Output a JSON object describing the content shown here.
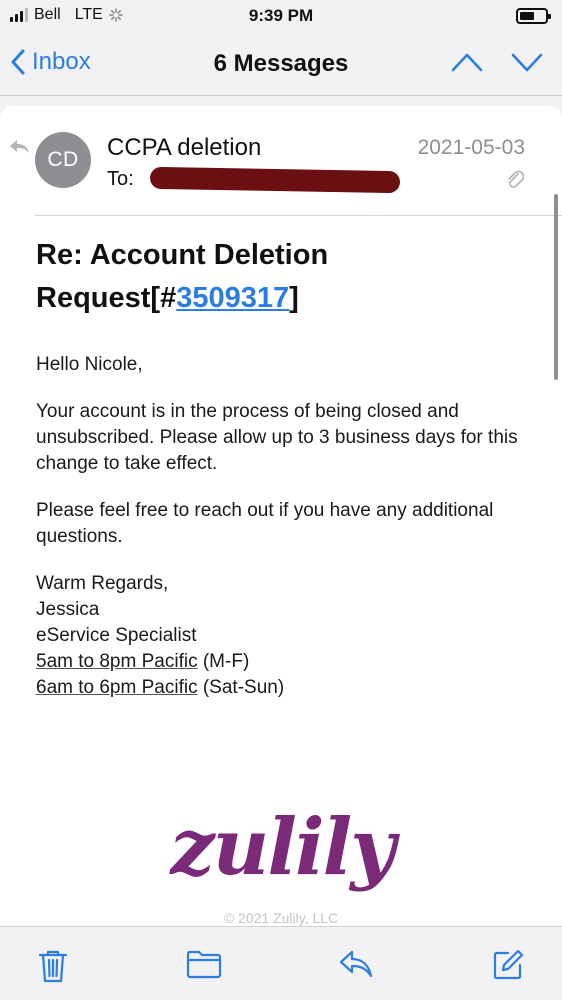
{
  "status": {
    "carrier": "Bell",
    "network": "LTE",
    "time": "9:39 PM"
  },
  "nav": {
    "back_label": "Inbox",
    "title": "6 Messages"
  },
  "message": {
    "avatar_initials": "CD",
    "sender": "CCPA deletion",
    "to_label": "To:",
    "date": "2021-05-03",
    "subject_prefix": "Re:  Account Deletion Request[#",
    "ticket_number": "3509317",
    "subject_suffix": "]",
    "greeting": "Hello Nicole,",
    "paragraph_1": "Your account is in the process of being closed and unsubscribed. Please allow up to 3 business days for this change to take effect.",
    "paragraph_2": "Please feel free to reach out if you have any additional questions.",
    "signoff": "Warm Regards,",
    "signer_name": "Jessica",
    "signer_title": "eService Specialist",
    "hours_1_link": "5am to 8pm Pacific",
    "hours_1_days": " (M-F)",
    "hours_2_link": "6am to 6pm Pacific",
    "hours_2_days": " (Sat-Sun)",
    "logo_text": "zulily",
    "copyright": "© 2021 Zulily, LLC"
  },
  "colors": {
    "accent": "#2a7de1",
    "redaction": "#6b0f12",
    "logo": "#7a2a78"
  },
  "icons": {
    "signal": "signal-bars-icon",
    "loading": "activity-spinner-icon",
    "battery": "battery-icon",
    "back": "chevron-left-icon",
    "prev": "chevron-up-icon",
    "next": "chevron-down-icon",
    "reply_indicator": "replied-arrow-icon",
    "attachment": "paperclip-icon",
    "trash": "trash-icon",
    "folder": "folder-icon",
    "reply": "reply-icon",
    "compose": "compose-icon"
  }
}
